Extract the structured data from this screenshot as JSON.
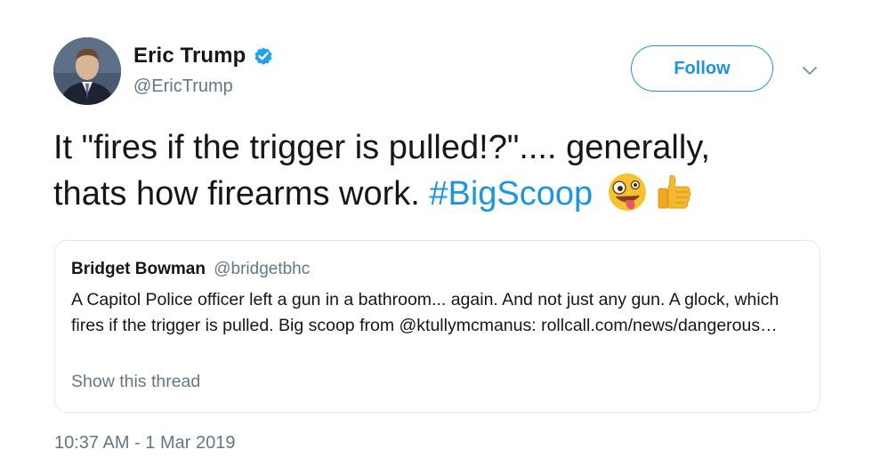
{
  "author": {
    "name": "Eric Trump",
    "handle": "@EricTrump",
    "verified": true
  },
  "follow_label": "Follow",
  "tweet": {
    "text_line1": "It \"fires if the trigger is pulled!?\".... generally,",
    "text_line2": "thats how firearms work. ",
    "hashtag": "#BigScoop",
    "emojis": [
      "zany-face-emoji",
      "thumbs-up-emoji"
    ]
  },
  "quote": {
    "name": "Bridget Bowman",
    "handle": "@bridgetbhc",
    "text": "A Capitol Police officer left a gun in a bathroom... again. And not just any gun. A glock, which fires if the trigger is pulled. Big scoop from @ktullymcmanus: rollcall.com/news/dangerous…",
    "show_thread": "Show this thread"
  },
  "timestamp": "10:37 AM - 1 Mar 2019",
  "colors": {
    "accent": "#1b95e0",
    "secondary_text": "#657786",
    "border": "#e1e8ed"
  }
}
